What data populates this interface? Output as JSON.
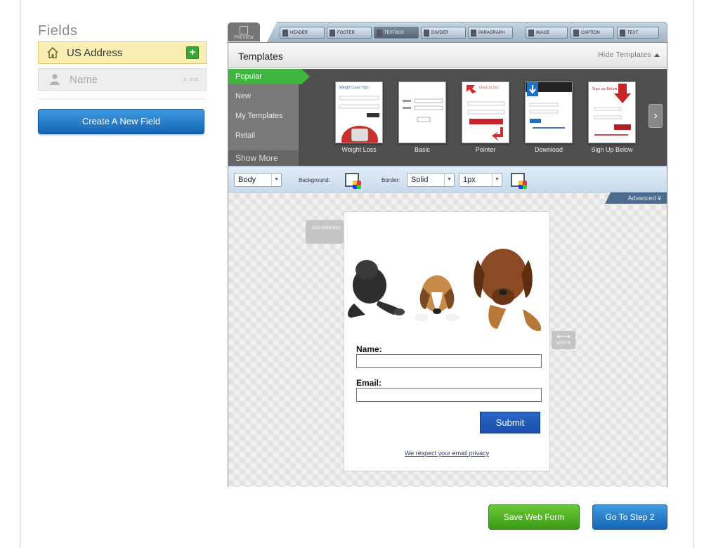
{
  "fields_panel": {
    "title": "Fields",
    "items": [
      {
        "label": "US Address",
        "icon": "home-icon",
        "action_icon": "add-icon",
        "highlight_color": "#fbeeb3"
      },
      {
        "label": "Name",
        "icon": "person-icon",
        "drag_hint": "≡ ≡≡"
      }
    ],
    "create_button": "Create A New Field"
  },
  "toolbar": {
    "preview_label": "PREVIEW",
    "buttons": [
      "HEADER",
      "FOOTER",
      "TEXTBOX",
      "DIVIDER",
      "PARAGRAPH",
      "IMAGE",
      "CAPTION",
      "TEXT"
    ]
  },
  "templates": {
    "header_title": "Templates",
    "hide_label": "Hide Templates",
    "categories": [
      "Popular",
      "New",
      "My Templates",
      "Retail"
    ],
    "active_category": "Popular",
    "show_more": "Show More",
    "thumbnails": [
      {
        "name": "Weight Loss"
      },
      {
        "name": "Basic"
      },
      {
        "name": "Pointer"
      },
      {
        "name": "Download"
      },
      {
        "name": "Sign Up Below"
      }
    ]
  },
  "style_bar": {
    "element_select": "Body",
    "background_label": "Background:",
    "border_label": "Border:",
    "border_style": "Solid",
    "border_width": "1px",
    "advanced_label": "Advanced"
  },
  "canvas": {
    "handle_left_label": "ADD PADDING",
    "handle_right_label": "WIDTH"
  },
  "form_preview": {
    "name_label": "Name:",
    "email_label": "Email:",
    "submit_label": "Submit",
    "privacy_text": "We respect your email privacy"
  },
  "actions": {
    "save_label": "Save Web Form",
    "next_label": "Go To Step 2"
  },
  "colors": {
    "green": "#3fb63f",
    "blue": "#1565b5",
    "submit_blue": "#1b4ea8"
  }
}
